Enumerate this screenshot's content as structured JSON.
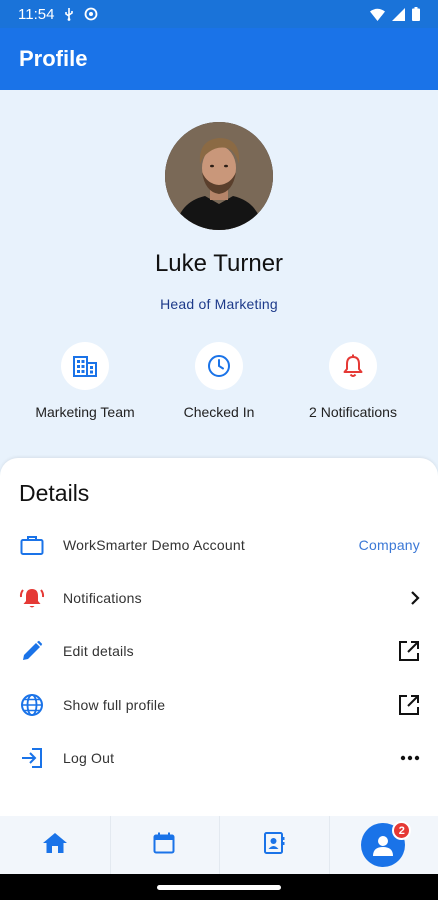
{
  "status_bar": {
    "time": "11:54",
    "icons": [
      "usb-icon",
      "sync-icon",
      "wifi-icon",
      "signal-icon",
      "battery-icon"
    ]
  },
  "app_bar": {
    "title": "Profile"
  },
  "profile": {
    "name": "Luke Turner",
    "role": "Head of Marketing",
    "stats": [
      {
        "label": "Marketing Team",
        "icon": "building-icon"
      },
      {
        "label": "Checked In",
        "icon": "clock-icon"
      },
      {
        "label": "2 Notifications",
        "icon": "bell-icon"
      }
    ]
  },
  "details": {
    "title": "Details",
    "rows": [
      {
        "label": "WorkSmarter Demo Account",
        "icon": "briefcase-icon",
        "right_text": "Company"
      },
      {
        "label": "Notifications",
        "icon": "alarm-bell-icon",
        "right_icon": "chevron-right-icon"
      },
      {
        "label": "Edit details",
        "icon": "pencil-icon",
        "right_icon": "open-external-icon"
      },
      {
        "label": "Show full profile",
        "icon": "globe-icon",
        "right_icon": "open-external-icon"
      },
      {
        "label": "Log Out",
        "icon": "logout-icon",
        "right_icon": "more-horizontal-icon"
      }
    ]
  },
  "bottom_nav": {
    "items": [
      "home-icon",
      "calendar-icon",
      "contacts-icon",
      "profile-icon"
    ],
    "profile_badge": "2"
  },
  "colors": {
    "primary": "#1a73e8",
    "background": "#e8f2fc",
    "alert_red": "#e53935",
    "link_blue": "#3b78d6",
    "role_blue": "#1d3a8a"
  }
}
